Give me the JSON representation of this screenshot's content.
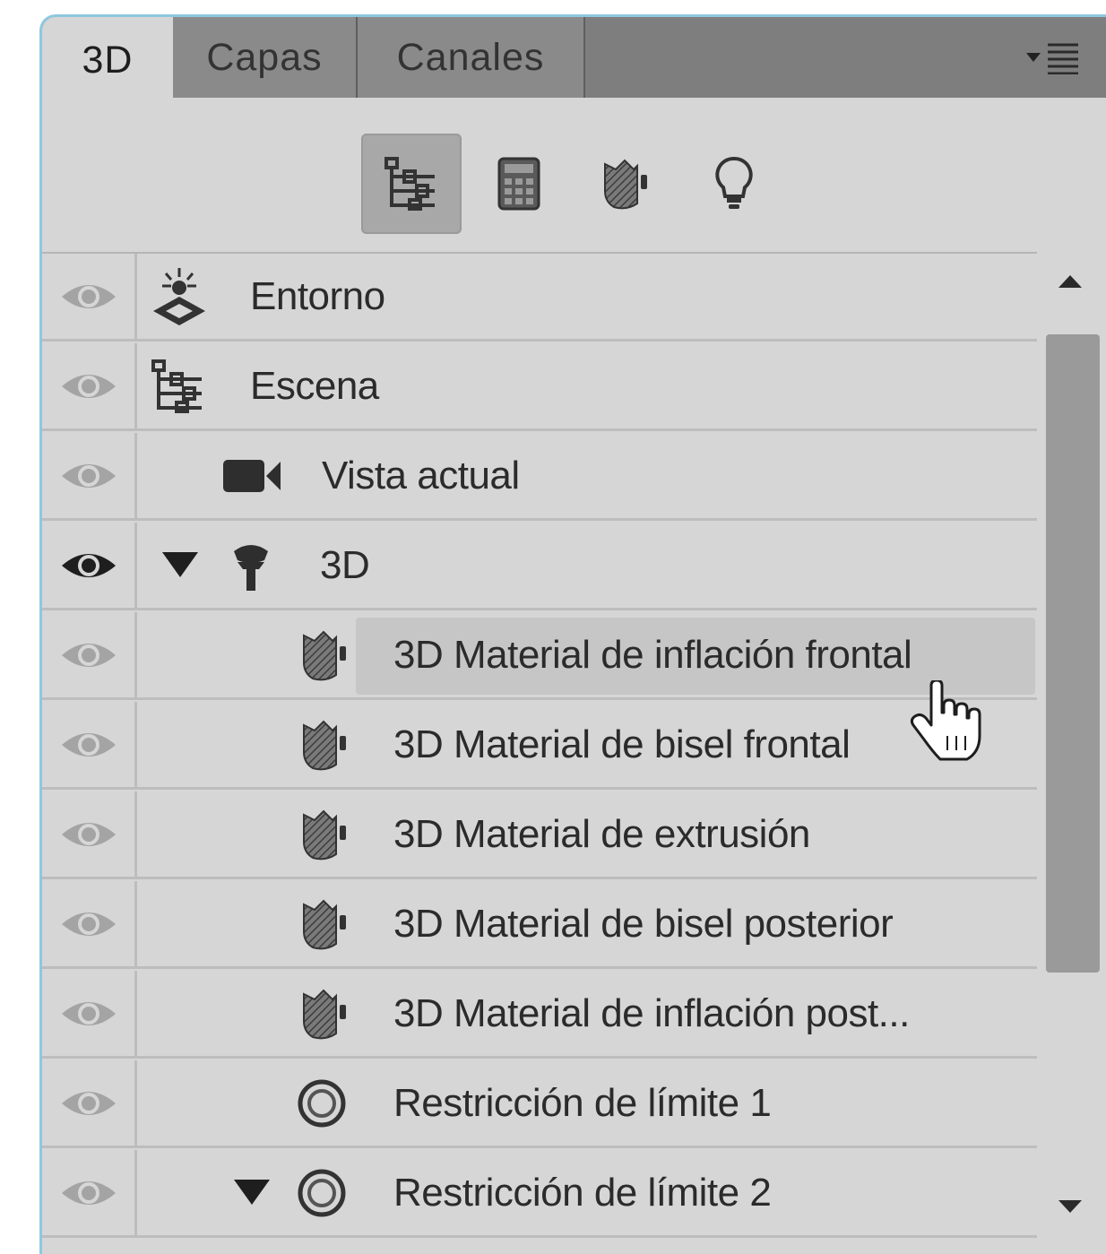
{
  "tabs": [
    {
      "label": "3D",
      "active": true
    },
    {
      "label": "Capas",
      "active": false
    },
    {
      "label": "Canales",
      "active": false
    }
  ],
  "panel_menu_icon": "panel-menu-icon",
  "toolbar": {
    "buttons": [
      {
        "icon": "scene-filter-icon",
        "pressed": true
      },
      {
        "icon": "mesh-filter-icon",
        "pressed": false
      },
      {
        "icon": "material-filter-icon",
        "pressed": false
      },
      {
        "icon": "light-filter-icon",
        "pressed": false
      }
    ]
  },
  "layers": [
    {
      "label": "Entorno",
      "icon": "environment-icon",
      "visible": false
    },
    {
      "label": "Escena",
      "icon": "scene-icon",
      "visible": false
    },
    {
      "label": "Vista actual",
      "icon": "camera-icon",
      "visible": false
    },
    {
      "label": "3D",
      "icon": "mesh-icon",
      "visible": true,
      "expanded": true
    },
    {
      "label": "3D Material de inflación frontal",
      "icon": "material-icon",
      "visible": false,
      "hovered": true
    },
    {
      "label": "3D Material de bisel frontal",
      "icon": "material-icon",
      "visible": false
    },
    {
      "label": "3D Material de extrusión",
      "icon": "material-icon",
      "visible": false
    },
    {
      "label": "3D Material de bisel posterior",
      "icon": "material-icon",
      "visible": false
    },
    {
      "label": "3D Material de inflación post...",
      "icon": "material-icon",
      "visible": false
    },
    {
      "label": "Restricción de límite 1",
      "icon": "constraint-icon",
      "visible": false
    },
    {
      "label": "Restricción de límite 2",
      "icon": "constraint-icon",
      "visible": false,
      "expanded": true
    }
  ],
  "colors": {
    "panel_bg": "#d6d6d6",
    "tab_bar_bg": "#7e7e7e",
    "frame_accent": "#8ec8df",
    "hover_row_bg": "#c6c6c6",
    "text": "#2b2b2b"
  }
}
